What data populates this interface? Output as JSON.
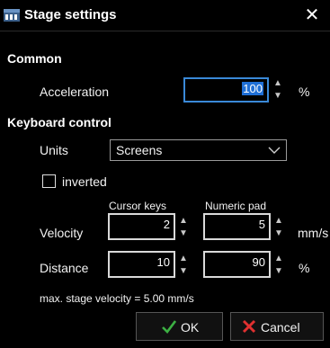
{
  "window": {
    "title": "Stage settings",
    "close_glyph": "✕"
  },
  "common": {
    "heading": "Common",
    "acceleration_label": "Acceleration",
    "acceleration_value": "100",
    "acceleration_unit": "%"
  },
  "keyboard": {
    "heading": "Keyboard control",
    "units_label": "Units",
    "units_value": "Screens",
    "inverted_label": "inverted",
    "inverted_checked": false,
    "col_cursor": "Cursor keys",
    "col_numeric": "Numeric pad",
    "velocity_label": "Velocity",
    "velocity_cursor": "2",
    "velocity_numeric": "5",
    "velocity_unit": "mm/s",
    "distance_label": "Distance",
    "distance_cursor": "10",
    "distance_numeric": "90",
    "distance_unit": "%"
  },
  "footer": {
    "max_velocity_text": "max. stage velocity = 5.00 mm/s"
  },
  "buttons": {
    "ok_label": "OK",
    "cancel_label": "Cancel"
  },
  "colors": {
    "background": "#000000",
    "focus_border": "#3a89d8",
    "selection": "#1f6fd6",
    "ok_icon": "#3cb043",
    "cancel_icon": "#e03030"
  },
  "icons": {
    "app": "microscope-app-icon",
    "close": "close-icon",
    "spin_up": "chevron-up-icon",
    "spin_down": "chevron-down-icon",
    "combo": "chevron-down-icon",
    "ok": "checkmark-icon",
    "cancel": "x-mark-icon"
  }
}
